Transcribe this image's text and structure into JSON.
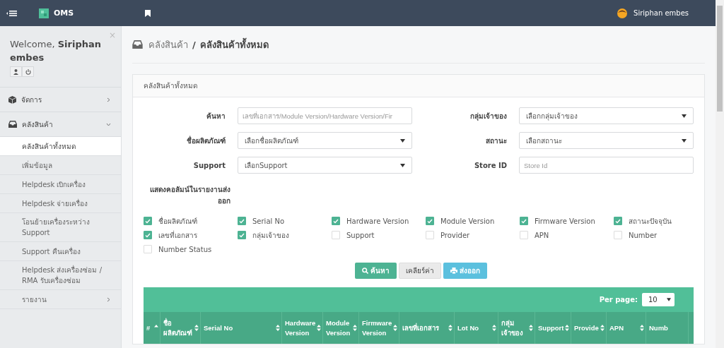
{
  "navbar": {
    "brand": "OMS",
    "user": "Siriphan embes"
  },
  "sidebar": {
    "close": "×",
    "welcome": "Welcome,",
    "user": "Siriphan embes",
    "menu": [
      {
        "label": "จัดการ",
        "expanded": false
      },
      {
        "label": "คลังสินค้า",
        "expanded": true,
        "children": [
          {
            "label": "คลังสินค้าทั้งหมด",
            "kind": "link",
            "selected": true
          },
          {
            "label": "เพิ่มข้อมูล",
            "kind": "link",
            "selected": false
          },
          {
            "label": "Helpdesk เบิกเครื่อง",
            "kind": "link",
            "selected": false
          },
          {
            "label": "Helpdesk จ่ายเครื่อง",
            "kind": "link",
            "selected": false
          },
          {
            "label": "โอนย้ายเครื่องระหว่าง Support",
            "kind": "link",
            "selected": false
          },
          {
            "label": "Support คืนเครื่อง",
            "kind": "link",
            "selected": false
          },
          {
            "label": "Helpdesk ส่งเครื่องซ่อม / RMA รับเครื่องซ่อม",
            "kind": "link",
            "selected": false
          },
          {
            "label": "รายงาน",
            "kind": "submenu",
            "selected": false
          }
        ]
      }
    ]
  },
  "breadcrumb": {
    "parent": "คลังสินค้า",
    "separator": "/",
    "current": "คลังสินค้าทั้งหมด"
  },
  "panel": {
    "title": "คลังสินค้าทั้งหมด",
    "fields": [
      {
        "label": "ค้นหา",
        "kind": "text",
        "placeholder": "เลขที่เอกสาร/Module Version/Hardware Version/Fir"
      },
      {
        "label": "กลุ่มเจ้าของ",
        "kind": "select",
        "value": "เลือกกลุ่มเจ้าของ"
      },
      {
        "label": "ชื่อผลิตภัณฑ์",
        "kind": "select",
        "value": "เลือกชื่อผลิตภัณฑ์"
      },
      {
        "label": "สถานะ",
        "kind": "select",
        "value": "เลือกสถานะ"
      },
      {
        "label": "Support",
        "kind": "select",
        "value": "เลือกSupport"
      },
      {
        "label": "Store ID",
        "kind": "text",
        "placeholder": "Store Id"
      }
    ],
    "columns_label": "แสดงคอลัมน์ในรายงานส่งออก",
    "columns": [
      {
        "label": "ชื่อผลิตภัณฑ์",
        "checked": true
      },
      {
        "label": "Serial No",
        "checked": true
      },
      {
        "label": "Hardware Version",
        "checked": true
      },
      {
        "label": "Module Version",
        "checked": true
      },
      {
        "label": "Firmware Version",
        "checked": true
      },
      {
        "label": "สถานะปัจจุบัน",
        "checked": true
      },
      {
        "label": "เลขที่เอกสาร",
        "checked": true
      },
      {
        "label": "กลุ่มเจ้าของ",
        "checked": true
      },
      {
        "label": "Support",
        "checked": false
      },
      {
        "label": "Provider",
        "checked": false
      },
      {
        "label": "APN",
        "checked": false
      },
      {
        "label": "Number",
        "checked": false
      },
      {
        "label": "Number Status",
        "checked": false
      }
    ],
    "buttons": [
      {
        "label": "ค้นหา",
        "kind": "primary"
      },
      {
        "label": "เคลียร์ค่า",
        "kind": "default"
      },
      {
        "label": "ส่งออก",
        "kind": "info"
      }
    ]
  },
  "table": {
    "per_page_label": "Per page:",
    "per_page": "10",
    "columns": [
      {
        "label": "#",
        "sorted": true
      },
      {
        "label": "ชื่อ ผลิตภัณฑ์",
        "sorted": false
      },
      {
        "label": "Serial No",
        "sorted": false
      },
      {
        "label": "Hardware Version",
        "sorted": false
      },
      {
        "label": "Module Version",
        "sorted": false
      },
      {
        "label": "Firmware Version",
        "sorted": false
      },
      {
        "label": "เลขที่เอกสาร",
        "sorted": false
      },
      {
        "label": "Lot No",
        "sorted": false
      },
      {
        "label": "กลุ่ม เจ้าของ",
        "sorted": false
      },
      {
        "label": "Support",
        "sorted": false
      },
      {
        "label": "Provide",
        "sorted": false
      },
      {
        "label": "APN",
        "sorted": false
      },
      {
        "label": "Numb"
      }
    ]
  }
}
